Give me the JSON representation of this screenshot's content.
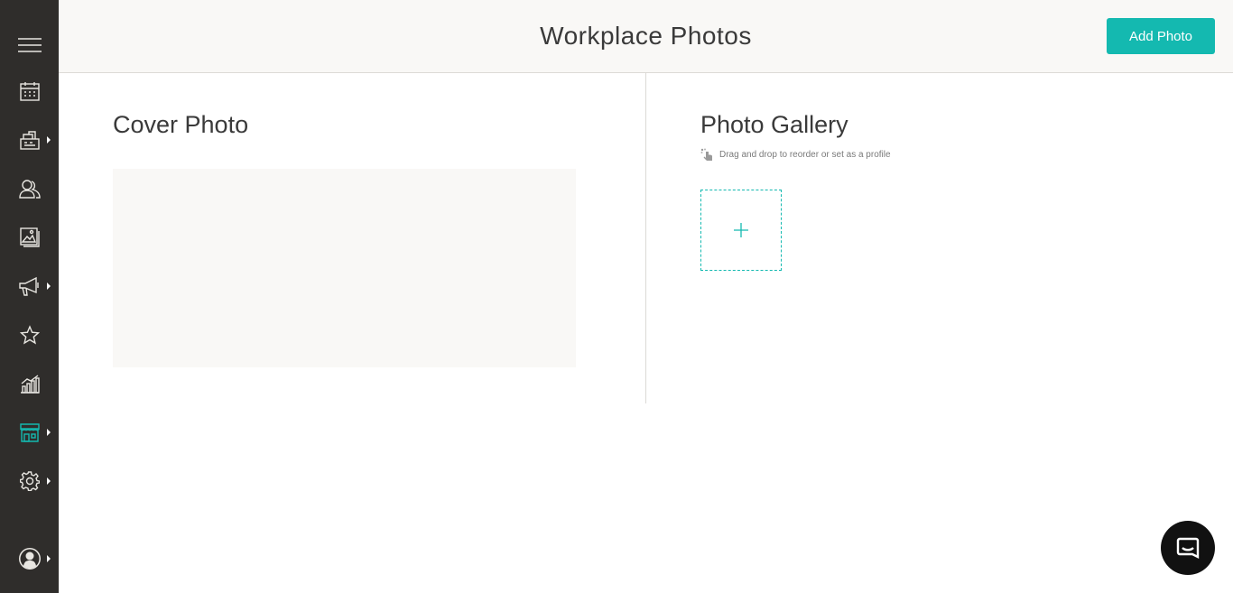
{
  "header": {
    "title": "Workplace Photos",
    "add_photo_label": "Add Photo"
  },
  "sidebar": {
    "items": [
      {
        "icon": "menu-icon",
        "has_submenu": false
      },
      {
        "icon": "calendar-icon",
        "has_submenu": false
      },
      {
        "icon": "register-icon",
        "has_submenu": true
      },
      {
        "icon": "users-icon",
        "has_submenu": false
      },
      {
        "icon": "photos-icon",
        "has_submenu": false
      },
      {
        "icon": "megaphone-icon",
        "has_submenu": true
      },
      {
        "icon": "star-icon",
        "has_submenu": false
      },
      {
        "icon": "chart-icon",
        "has_submenu": false
      },
      {
        "icon": "storefront-icon",
        "has_submenu": true,
        "active": true
      },
      {
        "icon": "gear-icon",
        "has_submenu": true
      },
      {
        "icon": "profile-icon",
        "has_submenu": true
      }
    ]
  },
  "cover": {
    "title": "Cover Photo"
  },
  "gallery": {
    "title": "Photo Gallery",
    "hint": "Drag and drop to reorder or set as a profile",
    "add_symbol": "+"
  },
  "colors": {
    "accent": "#14b9b0",
    "sidebar_bg": "#2f2d2b",
    "header_bg": "#f9f8f6",
    "icon": "#e8e6e1"
  }
}
